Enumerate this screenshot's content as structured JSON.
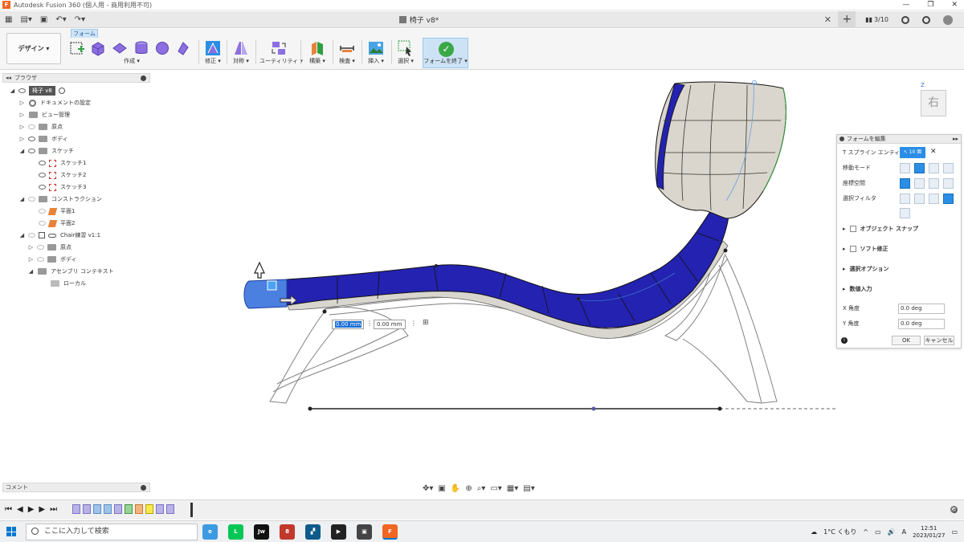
{
  "window": {
    "title": "Autodesk Fusion 360 (個人用 - 商用利用不可)",
    "controls": [
      "—",
      "❐",
      "✕"
    ]
  },
  "document": {
    "tab_title": "椅子 v8*",
    "job_count": "3/10"
  },
  "ribbon": {
    "workspace": "デザイン ▾",
    "active_tab": "フォーム",
    "groups": {
      "create": "作成 ▾",
      "modify": "修正 ▾",
      "symmetry": "対称 ▾",
      "utility": "ユーティリティ ▾",
      "construct": "構築 ▾",
      "inspect": "検査 ▾",
      "insert": "挿入 ▾",
      "select": "選択 ▾",
      "finish": "フォームを終了 ▾"
    }
  },
  "browser": {
    "header": "ブラウザ",
    "root": "椅子 v8",
    "items": [
      "ドキュメントの設定",
      "ビュー管理",
      "原点",
      "ボディ",
      "スケッチ",
      "スケッチ1",
      "スケッチ2",
      "スケッチ3",
      "コンストラクション",
      "平面1",
      "平面2",
      "Chair練習 v1:1",
      "原点",
      "ボディ",
      "アセンブリ コンテキスト",
      "ローカル"
    ]
  },
  "comments": {
    "label": "コメント"
  },
  "viewport": {
    "dim1": "0.00 mm",
    "dim2": "0.00 mm",
    "viewcube_face": "右",
    "axis_z": "Z"
  },
  "edit_panel": {
    "title": "フォームを編集",
    "tspline_label": "T スプライン エンティティ",
    "tspline_count": "10 面",
    "transform_mode": "移動モード",
    "coordinate_space": "座標空間",
    "selection_filter": "選択フィルタ",
    "object_snap": "オブジェクト スナップ",
    "soft_modify": "ソフト修正",
    "selection_options": "選択オプション",
    "numeric_input": "数値入力",
    "x_angle_label": "X 角度",
    "x_angle_value": "0.0 deg",
    "y_angle_label": "Y 角度",
    "y_angle_value": "0.0 deg",
    "ok": "OK",
    "cancel": "キャンセル"
  },
  "taskbar": {
    "search_placeholder": "ここに入力して検索",
    "weather": "1°C くもり",
    "ime": "A",
    "time": "12:51",
    "date": "2023/01/27"
  },
  "colors": {
    "accent": "#2a8ee6",
    "body_blue": "#2422b0",
    "finish_green": "#3aa845",
    "selected_feature": "#f7e94a"
  }
}
